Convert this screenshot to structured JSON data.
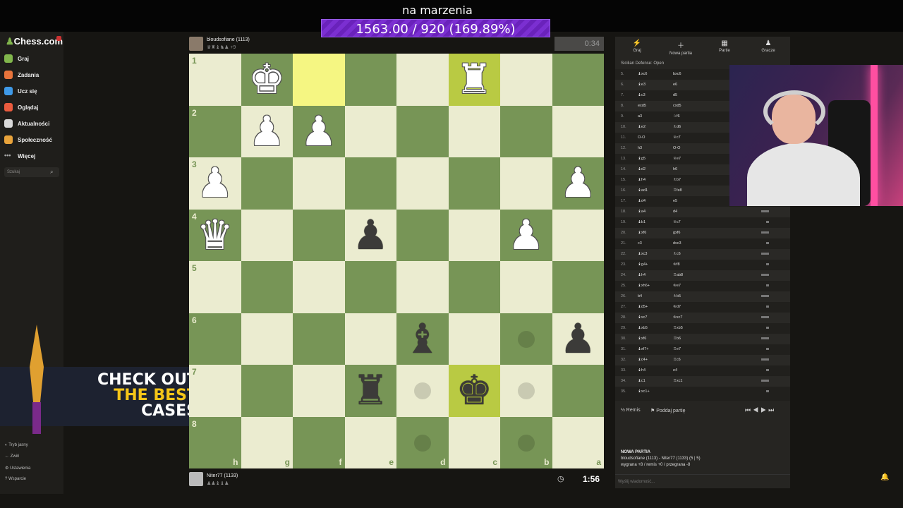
{
  "stream": {
    "title": "na marzenia",
    "goal": "1563.00 / 920 (169.89%)"
  },
  "sidebar": {
    "logo": "Chess.com",
    "items": [
      {
        "label": "Graj",
        "color": "#81b64c"
      },
      {
        "label": "Zadania",
        "color": "#e8743b"
      },
      {
        "label": "Ucz się",
        "color": "#3f9ae8"
      },
      {
        "label": "Oglądaj",
        "color": "#ea5b3e"
      },
      {
        "label": "Aktualności",
        "color": "#d9d9d9"
      },
      {
        "label": "Społeczność",
        "color": "#e8a33b"
      },
      {
        "label": "Więcej",
        "color": "#aaaaaa"
      }
    ],
    "search_placeholder": "Szukaj",
    "footer": [
      "Tryb jasny",
      "Zwiń",
      "Ustawienia",
      "Wsparcie"
    ]
  },
  "ad": {
    "line1": "CHECK OUT",
    "line2": "THE BEST",
    "line3": "CASES"
  },
  "players": {
    "top": {
      "name": "bloudsofiane (1113)"
    },
    "bottom": {
      "name": "Niter77 (1133)"
    }
  },
  "clocks": {
    "top": "0:34",
    "bottom": "1:56"
  },
  "board": {
    "ranks": [
      "1",
      "2",
      "3",
      "4",
      "5",
      "6",
      "7",
      "8"
    ],
    "files": [
      "h",
      "g",
      "f",
      "e",
      "d",
      "c",
      "b",
      "a"
    ],
    "pieces": [
      {
        "sq": "g1",
        "glyph": "♚",
        "side": "w"
      },
      {
        "sq": "c1",
        "glyph": "♜",
        "side": "w"
      },
      {
        "sq": "g2",
        "glyph": "♟",
        "side": "w"
      },
      {
        "sq": "f2",
        "glyph": "♟",
        "side": "w"
      },
      {
        "sq": "h3",
        "glyph": "♟",
        "side": "w"
      },
      {
        "sq": "a3",
        "glyph": "♟",
        "side": "w"
      },
      {
        "sq": "h4",
        "glyph": "♛",
        "side": "w"
      },
      {
        "sq": "e4",
        "glyph": "♟",
        "side": "b"
      },
      {
        "sq": "b4",
        "glyph": "♟",
        "side": "w"
      },
      {
        "sq": "d6",
        "glyph": "♝",
        "side": "b"
      },
      {
        "sq": "a6",
        "glyph": "♟",
        "side": "b"
      },
      {
        "sq": "e7",
        "glyph": "♜",
        "side": "b"
      },
      {
        "sq": "c7",
        "glyph": "♚",
        "side": "b"
      }
    ],
    "highlights": [
      "f1",
      "c1",
      "c7"
    ],
    "hints": [
      "b6",
      "d7",
      "b7",
      "d8",
      "b8"
    ]
  },
  "panel": {
    "tabs": [
      {
        "label": "Graj",
        "icon": "⚡"
      },
      {
        "label": "Nowa partia",
        "icon": "＋"
      },
      {
        "label": "Partie",
        "icon": "▦"
      },
      {
        "label": "Gracze",
        "icon": "♟"
      }
    ],
    "opening": "Sicilian Defense: Open",
    "moves": [
      {
        "n": "5.",
        "w": "♝xc6",
        "b": "bxc6"
      },
      {
        "n": "6.",
        "w": "♝e3",
        "b": "e6"
      },
      {
        "n": "7.",
        "w": "♝c3",
        "b": "d5"
      },
      {
        "n": "8.",
        "w": "exd5",
        "b": "cxd5"
      },
      {
        "n": "9.",
        "w": "a3",
        "b": "♘f6"
      },
      {
        "n": "10.",
        "w": "♝e2",
        "b": "♗d6"
      },
      {
        "n": "11.",
        "w": "O-O",
        "b": "♕c7"
      },
      {
        "n": "12.",
        "w": "h3",
        "b": "O-O"
      },
      {
        "n": "13.",
        "w": "♝g5",
        "b": "♕e7"
      },
      {
        "n": "14.",
        "w": "♝d2",
        "b": "h6"
      },
      {
        "n": "15.",
        "w": "♝h4",
        "b": "♗b7"
      },
      {
        "n": "16.",
        "w": "♝ad1",
        "b": "♖fe8"
      },
      {
        "n": "17.",
        "w": "♝d4",
        "b": "e5"
      },
      {
        "n": "18.",
        "w": "♝a4",
        "b": "d4"
      },
      {
        "n": "19.",
        "w": "♝b1",
        "b": "♕c7"
      },
      {
        "n": "20.",
        "w": "♝xf6",
        "b": "gxf6"
      },
      {
        "n": "21.",
        "w": "c3",
        "b": "dxc3"
      },
      {
        "n": "22.",
        "w": "♝xc3",
        "b": "♗c6"
      },
      {
        "n": "23.",
        "w": "♝g4+",
        "b": "♔f8"
      },
      {
        "n": "24.",
        "w": "♝h4",
        "b": "♖ab8"
      },
      {
        "n": "25.",
        "w": "♝xh6+",
        "b": "♔e7"
      },
      {
        "n": "26.",
        "w": "b4",
        "b": "♗b5"
      },
      {
        "n": "27.",
        "w": "♝d5+",
        "b": "♔d7"
      },
      {
        "n": "28.",
        "w": "♝xc7",
        "b": "♔xc7"
      },
      {
        "n": "29.",
        "w": "♝xb5",
        "b": "♖xb5"
      },
      {
        "n": "30.",
        "w": "♝xf6",
        "b": "♖b6"
      },
      {
        "n": "31.",
        "w": "♝xf7+",
        "b": "♖e7"
      },
      {
        "n": "32.",
        "w": "♝c4+",
        "b": "♖c6"
      },
      {
        "n": "33.",
        "w": "♝h4",
        "b": "e4"
      },
      {
        "n": "34.",
        "w": "♝c1",
        "b": "♖xc1"
      },
      {
        "n": "35.",
        "w": "♝xc1+",
        "b": ""
      }
    ],
    "draw_label": "Remis",
    "resign_label": "Poddaj partię",
    "newgame_title": "NOWA PARTIA",
    "newgame_line1": "bloudsofiane (1113) - Niter77 (1133) (5 | 5)",
    "newgame_line2": "wygrana +8 / remis +0 / przegrana -8",
    "chat_placeholder": "Wyślij wiadomość..."
  }
}
